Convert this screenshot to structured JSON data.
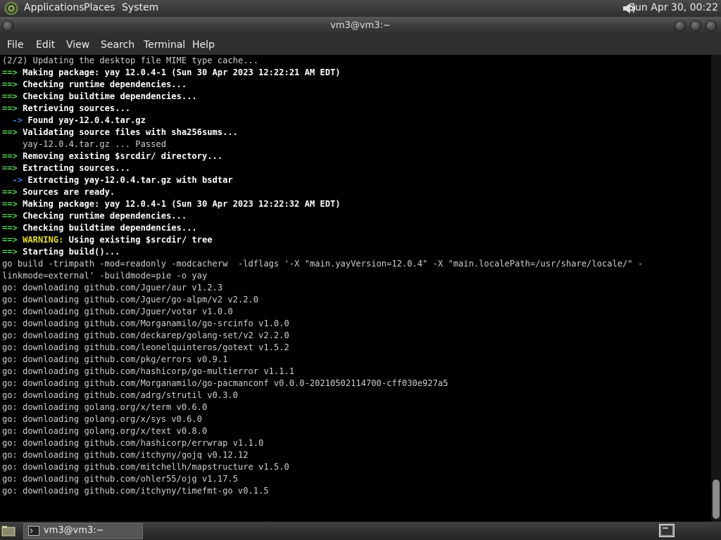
{
  "top_panel": {
    "menus": [
      "Applications",
      "Places",
      "System"
    ],
    "clock": "Sun Apr 30, 00:22"
  },
  "window": {
    "title": "vm3@vm3:~"
  },
  "menu_bar": [
    "File",
    "Edit",
    "View",
    "Search",
    "Terminal",
    "Help"
  ],
  "terminal": {
    "lines": [
      [
        {
          "t": "(2/2) Updating the desktop file MIME type cache..."
        }
      ],
      [
        {
          "t": "==>",
          "c": "arrow"
        },
        {
          "t": " Making package: yay 12.0.4-1 (Sun 30 Apr 2023 12:22:21 AM EDT)",
          "c": "bold"
        }
      ],
      [
        {
          "t": "==>",
          "c": "arrow"
        },
        {
          "t": " Checking runtime dependencies...",
          "c": "bold"
        }
      ],
      [
        {
          "t": "==>",
          "c": "arrow"
        },
        {
          "t": " Checking buildtime dependencies...",
          "c": "bold"
        }
      ],
      [
        {
          "t": "==>",
          "c": "arrow"
        },
        {
          "t": " Retrieving sources...",
          "c": "bold"
        }
      ],
      [
        {
          "t": "  ->",
          "c": "sub"
        },
        {
          "t": " Found yay-12.0.4.tar.gz",
          "c": "bold"
        }
      ],
      [
        {
          "t": "==>",
          "c": "arrow"
        },
        {
          "t": " Validating source files with sha256sums...",
          "c": "bold"
        }
      ],
      [
        {
          "t": "    yay-12.0.4.tar.gz ... Passed"
        }
      ],
      [
        {
          "t": "==>",
          "c": "arrow"
        },
        {
          "t": " Removing existing $srcdir/ directory...",
          "c": "bold"
        }
      ],
      [
        {
          "t": "==>",
          "c": "arrow"
        },
        {
          "t": " Extracting sources...",
          "c": "bold"
        }
      ],
      [
        {
          "t": "  ->",
          "c": "sub"
        },
        {
          "t": " Extracting yay-12.0.4.tar.gz with bsdtar",
          "c": "bold"
        }
      ],
      [
        {
          "t": "==>",
          "c": "arrow"
        },
        {
          "t": " Sources are ready.",
          "c": "bold"
        }
      ],
      [
        {
          "t": "==>",
          "c": "arrow"
        },
        {
          "t": " Making package: yay 12.0.4-1 (Sun 30 Apr 2023 12:22:32 AM EDT)",
          "c": "bold"
        }
      ],
      [
        {
          "t": "==>",
          "c": "arrow"
        },
        {
          "t": " Checking runtime dependencies...",
          "c": "bold"
        }
      ],
      [
        {
          "t": "==>",
          "c": "arrow"
        },
        {
          "t": " Checking buildtime dependencies...",
          "c": "bold"
        }
      ],
      [
        {
          "t": "==>",
          "c": "arrow"
        },
        {
          "t": " WARNING:",
          "c": "warn"
        },
        {
          "t": " Using existing $srcdir/ tree",
          "c": "bold"
        }
      ],
      [
        {
          "t": "==>",
          "c": "arrow"
        },
        {
          "t": " Starting build()...",
          "c": "bold"
        }
      ],
      [
        {
          "t": "go build -trimpath -mod=readonly -modcacherw  -ldflags '-X \"main.yayVersion=12.0.4\" -X \"main.localePath=/usr/share/locale/\" -"
        }
      ],
      [
        {
          "t": "linkmode=external' -buildmode=pie -o yay"
        }
      ],
      [
        {
          "t": "go: downloading github.com/Jguer/aur v1.2.3"
        }
      ],
      [
        {
          "t": "go: downloading github.com/Jguer/go-alpm/v2 v2.2.0"
        }
      ],
      [
        {
          "t": "go: downloading github.com/Jguer/votar v1.0.0"
        }
      ],
      [
        {
          "t": "go: downloading github.com/Morganamilo/go-srcinfo v1.0.0"
        }
      ],
      [
        {
          "t": "go: downloading github.com/deckarep/golang-set/v2 v2.2.0"
        }
      ],
      [
        {
          "t": "go: downloading github.com/leonelquinteros/gotext v1.5.2"
        }
      ],
      [
        {
          "t": "go: downloading github.com/pkg/errors v0.9.1"
        }
      ],
      [
        {
          "t": "go: downloading github.com/hashicorp/go-multierror v1.1.1"
        }
      ],
      [
        {
          "t": "go: downloading github.com/Morganamilo/go-pacmanconf v0.0.0-20210502114700-cff030e927a5"
        }
      ],
      [
        {
          "t": "go: downloading github.com/adrg/strutil v0.3.0"
        }
      ],
      [
        {
          "t": "go: downloading golang.org/x/term v0.6.0"
        }
      ],
      [
        {
          "t": "go: downloading golang.org/x/sys v0.6.0"
        }
      ],
      [
        {
          "t": "go: downloading golang.org/x/text v0.8.0"
        }
      ],
      [
        {
          "t": "go: downloading github.com/hashicorp/errwrap v1.1.0"
        }
      ],
      [
        {
          "t": "go: downloading github.com/itchyny/gojq v0.12.12"
        }
      ],
      [
        {
          "t": "go: downloading github.com/mitchellh/mapstructure v1.5.0"
        }
      ],
      [
        {
          "t": "go: downloading github.com/ohler55/ojg v1.17.5"
        }
      ],
      [
        {
          "t": "go: downloading github.com/itchyny/timefmt-go v0.1.5"
        }
      ]
    ]
  },
  "taskbar": {
    "task_label": "vm3@vm3:~"
  },
  "icons": {
    "apps": "gnome-foot-icon",
    "volume": "speaker-icon",
    "show_desktop": "desktop-icon",
    "task": "terminal-icon",
    "workspace": "workspace-switcher-icon"
  }
}
